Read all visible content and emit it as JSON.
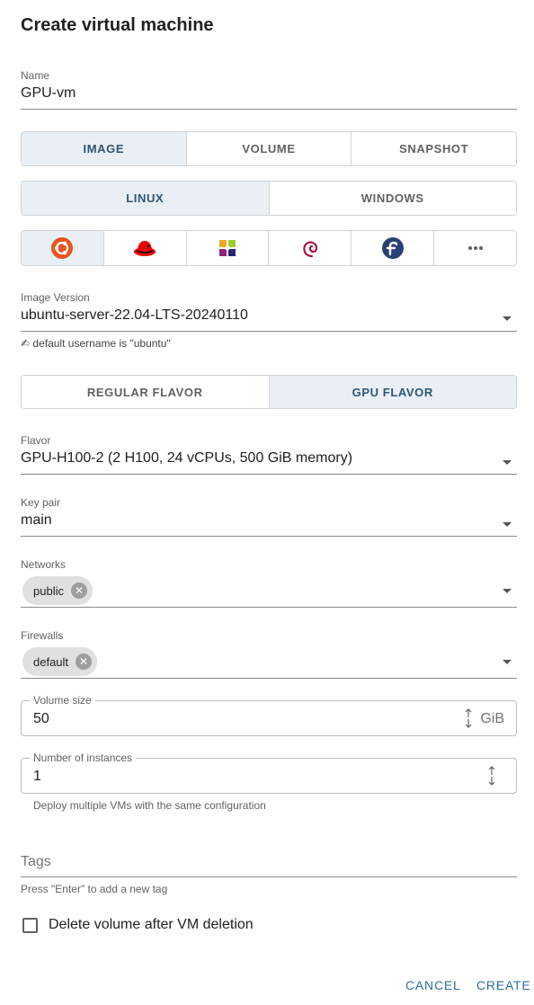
{
  "dialog": {
    "title": "Create virtual machine"
  },
  "name_field": {
    "label": "Name",
    "value": "GPU-vm"
  },
  "source_tabs": [
    {
      "label": "IMAGE",
      "active": true
    },
    {
      "label": "VOLUME",
      "active": false
    },
    {
      "label": "SNAPSHOT",
      "active": false
    }
  ],
  "os_tabs": [
    {
      "label": "LINUX",
      "active": true
    },
    {
      "label": "WINDOWS",
      "active": false
    }
  ],
  "distro_icons": [
    "ubuntu-icon",
    "redhat-icon",
    "centos-icon",
    "debian-icon",
    "fedora-icon",
    "more-icon"
  ],
  "image_version": {
    "label": "Image Version",
    "value": "ubuntu-server-22.04-LTS-20240110",
    "hint_icon": "writing-hand-icon",
    "hint": "default username is \"ubuntu\""
  },
  "flavor_tabs": [
    {
      "label": "REGULAR FLAVOR",
      "active": false
    },
    {
      "label": "GPU FLAVOR",
      "active": true
    }
  ],
  "flavor": {
    "label": "Flavor",
    "value": "GPU-H100-2 (2 H100, 24 vCPUs, 500 GiB memory)"
  },
  "key_pair": {
    "label": "Key pair",
    "value": "main"
  },
  "networks": {
    "label": "Networks",
    "chips": [
      "public"
    ]
  },
  "firewalls": {
    "label": "Firewalls",
    "chips": [
      "default"
    ]
  },
  "volume_size": {
    "label": "Volume size",
    "value": "50",
    "unit": "GiB"
  },
  "instances": {
    "label": "Number of instances",
    "value": "1",
    "helper": "Deploy multiple VMs with the same configuration"
  },
  "tags": {
    "placeholder": "Tags",
    "helper": "Press \"Enter\" to add a new tag"
  },
  "delete_volume": {
    "label": "Delete volume after VM deletion",
    "checked": false
  },
  "actions": {
    "cancel": "CANCEL",
    "create": "CREATE"
  },
  "colors": {
    "accent": "#2f6f9f",
    "active_segment": "#e9eff4",
    "active_text": "#2d5673",
    "ubuntu": "#e95420"
  }
}
